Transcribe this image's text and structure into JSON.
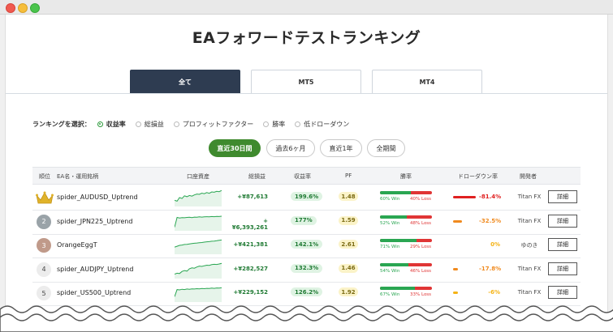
{
  "page_title": "EAフォワードテストランキング",
  "tabs": [
    {
      "label": "全て",
      "active": true
    },
    {
      "label": "MT5",
      "active": false
    },
    {
      "label": "MT4",
      "active": false
    }
  ],
  "ranking_select": {
    "label": "ランキングを選択：",
    "options": [
      {
        "label": "収益率",
        "selected": true
      },
      {
        "label": "総損益",
        "selected": false
      },
      {
        "label": "プロフィットファクター",
        "selected": false
      },
      {
        "label": "勝率",
        "selected": false
      },
      {
        "label": "低ドローダウン",
        "selected": false
      }
    ]
  },
  "periods": [
    {
      "label": "直近30日間",
      "active": true
    },
    {
      "label": "過去6ヶ月",
      "active": false
    },
    {
      "label": "直近1年",
      "active": false
    },
    {
      "label": "全期間",
      "active": false
    }
  ],
  "table": {
    "headers": {
      "rank": "順位",
      "ea": "EA名・運用銘柄",
      "balance": "口座資産",
      "profit": "総損益",
      "return": "収益率",
      "pf": "PF",
      "win_rate": "勝率",
      "drawdown": "ドローダウン率",
      "developer": "開発者"
    },
    "rows": [
      {
        "rank": "1",
        "ea": "spider_AUDUSD_Uptrend",
        "profit": "+¥87,613",
        "return": "199.6%",
        "pf": "1.48",
        "win": 60,
        "win_label": "60% Win",
        "loss_label": "40% Loss",
        "dd": 81.4,
        "dd_label": "-81.4%",
        "developer": "Titan FX",
        "detail": "詳細",
        "spark": [
          0.35,
          0.3,
          0.5,
          0.45,
          0.6,
          0.55,
          0.62,
          0.58,
          0.65,
          0.7,
          0.68,
          0.75,
          0.72,
          0.78,
          0.74,
          0.82,
          0.8,
          0.85,
          0.83,
          0.9
        ]
      },
      {
        "rank": "2",
        "ea": "spider_JPN225_Uptrend",
        "profit": "+¥6,393,261",
        "return": "177%",
        "pf": "1.59",
        "win": 52,
        "win_label": "52% Win",
        "loss_label": "48% Loss",
        "dd": 32.5,
        "dd_label": "-32.5%",
        "developer": "Titan FX",
        "detail": "詳細",
        "spark": [
          0.2,
          0.75,
          0.72,
          0.74,
          0.73,
          0.75,
          0.76,
          0.74,
          0.77,
          0.76,
          0.78,
          0.77,
          0.78,
          0.79,
          0.78,
          0.8,
          0.79,
          0.81,
          0.8,
          0.82
        ]
      },
      {
        "rank": "3",
        "ea": "OrangeEggT",
        "profit": "+¥421,381",
        "return": "142.1%",
        "pf": "2.61",
        "win": 71,
        "win_label": "71% Win",
        "loss_label": "29% Loss",
        "dd": 0,
        "dd_label": "0%",
        "developer": "ゆのき",
        "detail": "詳細",
        "spark": [
          0.4,
          0.45,
          0.5,
          0.52,
          0.55,
          0.56,
          0.58,
          0.6,
          0.62,
          0.63,
          0.65,
          0.66,
          0.68,
          0.7,
          0.71,
          0.73,
          0.74,
          0.76,
          0.78,
          0.8
        ]
      },
      {
        "rank": "4",
        "ea": "spider_AUDJPY_Uptrend",
        "profit": "+¥282,527",
        "return": "132.3%",
        "pf": "1.46",
        "win": 54,
        "win_label": "54% Win",
        "loss_label": "46% Loss",
        "dd": 17.8,
        "dd_label": "-17.8%",
        "developer": "Titan FX",
        "detail": "詳細",
        "spark": [
          0.25,
          0.3,
          0.28,
          0.4,
          0.45,
          0.42,
          0.55,
          0.6,
          0.58,
          0.65,
          0.7,
          0.68,
          0.72,
          0.75,
          0.74,
          0.78,
          0.8,
          0.79,
          0.82,
          0.85
        ]
      },
      {
        "rank": "5",
        "ea": "spider_US500_Uptrend",
        "profit": "+¥229,152",
        "return": "126.2%",
        "pf": "1.92",
        "win": 67,
        "win_label": "67% Win",
        "loss_label": "33% Loss",
        "dd": 6,
        "dd_label": "-6%",
        "developer": "Titan FX",
        "detail": "詳細",
        "spark": [
          0.3,
          0.7,
          0.68,
          0.72,
          0.7,
          0.73,
          0.72,
          0.74,
          0.73,
          0.75,
          0.74,
          0.76,
          0.75,
          0.77,
          0.76,
          0.78,
          0.77,
          0.79,
          0.78,
          0.8
        ]
      }
    ]
  },
  "colors": {
    "tab_active": "#2e3c51",
    "period_active": "#3f8a2e",
    "profit": "#1f7a33",
    "win": "#2aa652",
    "loss": "#e03535",
    "dd_high": "#e02020",
    "dd_mid": "#f08a1e",
    "dd_low": "#f5b316"
  }
}
